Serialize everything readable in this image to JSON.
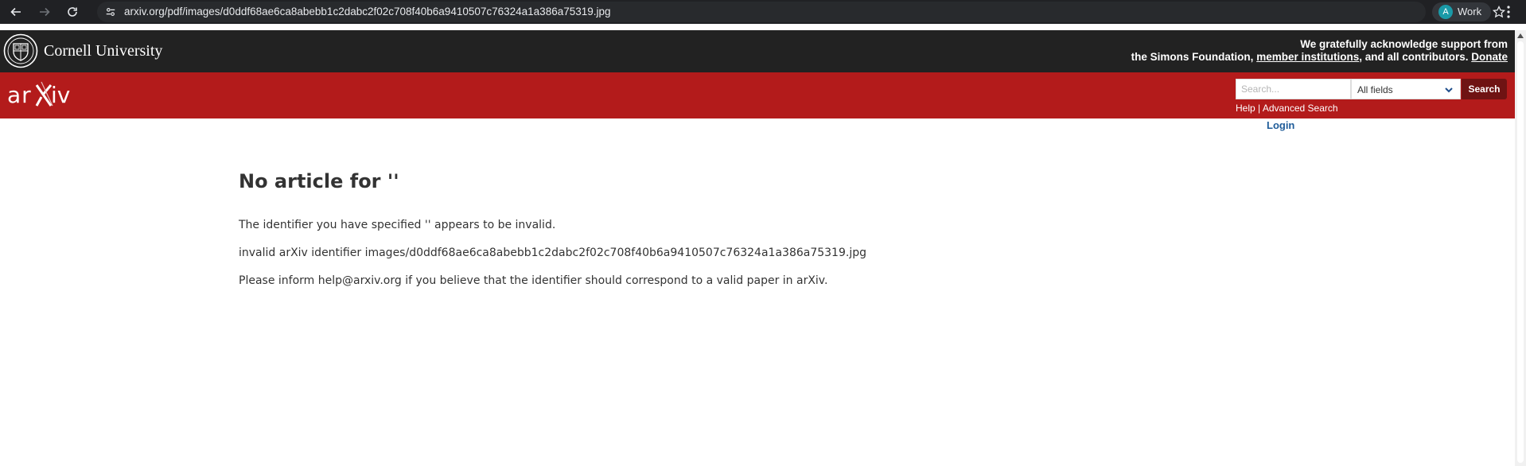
{
  "browser": {
    "url": "arxiv.org/pdf/images/d0ddf68ae6ca8abebb1c2dabc2f02c708f40b6a9410507c76324a1a386a75319.jpg",
    "profile_initial": "A",
    "profile_label": "Work",
    "icons": [
      "back-arrow-icon",
      "forward-arrow-icon",
      "reload-icon",
      "site-info-icon",
      "star-icon",
      "kebab-menu-icon"
    ]
  },
  "cornell": {
    "name": "Cornell University",
    "ack_line1": "We gratefully acknowledge support from",
    "ack_line2_prefix": "the Simons Foundation,",
    "ack_member_link": "member institutions",
    "ack_line2_suffix": ", and all contributors.",
    "donate_link": "Donate"
  },
  "arxiv_header": {
    "search_placeholder": "Search...",
    "field_selected": "All fields",
    "search_button": "Search",
    "help_link": "Help",
    "separator": "|",
    "advanced_link": "Advanced Search",
    "login_link": "Login",
    "brand_color": "#b31b1b"
  },
  "main": {
    "title": "No article for ''",
    "message1": "The identifier you have specified '' appears to be invalid.",
    "message2": "invalid arXiv identifier images/d0ddf68ae6ca8abebb1c2dabc2f02c708f40b6a9410507c76324a1a386a75319.jpg",
    "message3": "Please inform help@arxiv.org if you believe that the identifier should correspond to a valid paper in arXiv."
  }
}
